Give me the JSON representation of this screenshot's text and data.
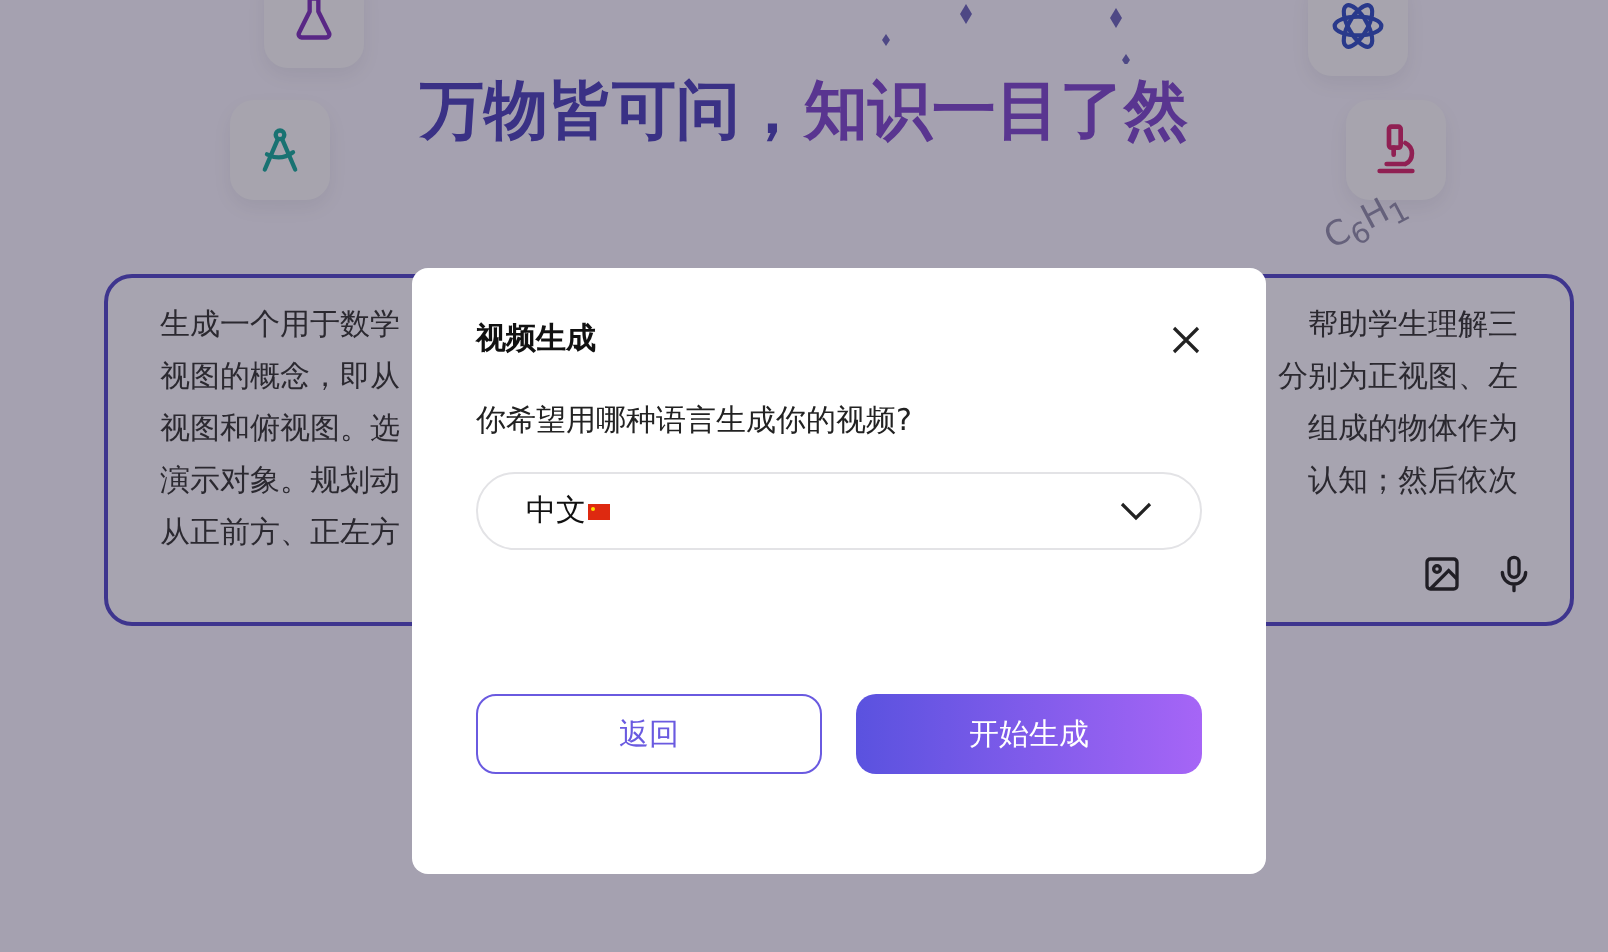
{
  "page": {
    "headline_left": "万物皆可问，",
    "headline_right": "知识一目了然",
    "formula": "C$_{6}$H$_{1}$",
    "prompt": {
      "left_lines": [
        "生成一个用于数学",
        "视图的概念，即从",
        "视图和俯视图。选",
        "演示对象。规划动",
        "从正前方、正左方"
      ],
      "right_lines": [
        "帮助学生理解三",
        "分别为正视图、左",
        "组成的物体作为",
        "认知；然后依次"
      ]
    }
  },
  "dialog": {
    "title": "视频生成",
    "question": "你希望用哪种语言生成你的视频?",
    "language": "中文",
    "buttons": [
      {
        "label": "返回",
        "kind": "secondary"
      },
      {
        "label": "开始生成",
        "kind": "primary"
      }
    ]
  }
}
